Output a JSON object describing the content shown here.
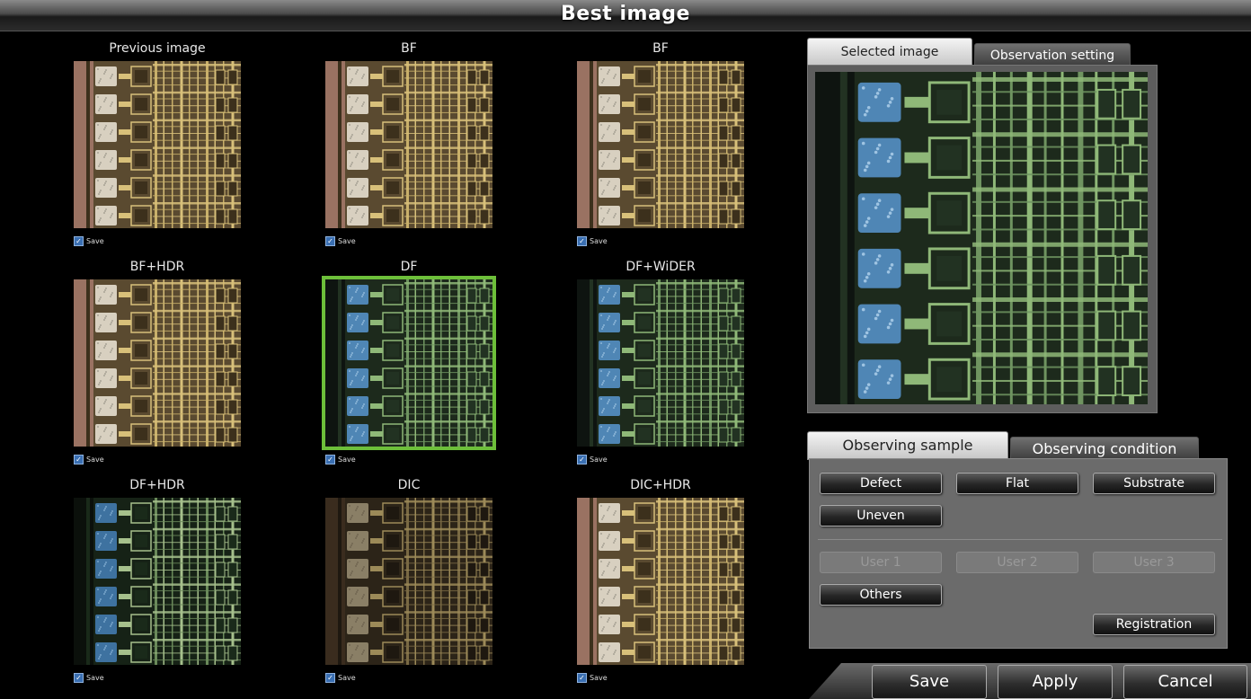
{
  "window": {
    "title": "Best image"
  },
  "thumbnails": [
    {
      "caption": "Previous image",
      "save_label": "Save",
      "style": "bf",
      "checked": true
    },
    {
      "caption": "BF",
      "save_label": "Save",
      "style": "bf",
      "checked": true
    },
    {
      "caption": "BF",
      "save_label": "Save",
      "style": "bf",
      "checked": true
    },
    {
      "caption": "BF+HDR",
      "save_label": "Save",
      "style": "bf",
      "checked": true
    },
    {
      "caption": "DF",
      "save_label": "Save",
      "style": "df",
      "checked": true,
      "selected": true
    },
    {
      "caption": "DF+WiDER",
      "save_label": "Save",
      "style": "df",
      "checked": true
    },
    {
      "caption": "DF+HDR",
      "save_label": "Save",
      "style": "dfdark",
      "checked": true
    },
    {
      "caption": "DIC",
      "save_label": "Save",
      "style": "dic",
      "checked": true
    },
    {
      "caption": "DIC+HDR",
      "save_label": "Save",
      "style": "bf",
      "checked": true
    }
  ],
  "top_tabs": {
    "selected_image": "Selected image",
    "observation_setting": "Observation setting"
  },
  "bottom_tabs": {
    "observing_sample": "Observing sample",
    "observing_condition": "Observing condition"
  },
  "sample_buttons": {
    "defect": "Defect",
    "flat": "Flat",
    "substrate": "Substrate",
    "uneven": "Uneven",
    "user1": "User 1",
    "user2": "User 2",
    "user3": "User 3",
    "others": "Others",
    "registration": "Registration"
  },
  "actions": {
    "save": "Save",
    "apply": "Apply",
    "cancel": "Cancel"
  },
  "colors": {
    "selection": "#6dbf3a",
    "bf_gold": "#c9b06a",
    "df_green": "#7fa36a",
    "df_blue": "#4f86b5"
  }
}
